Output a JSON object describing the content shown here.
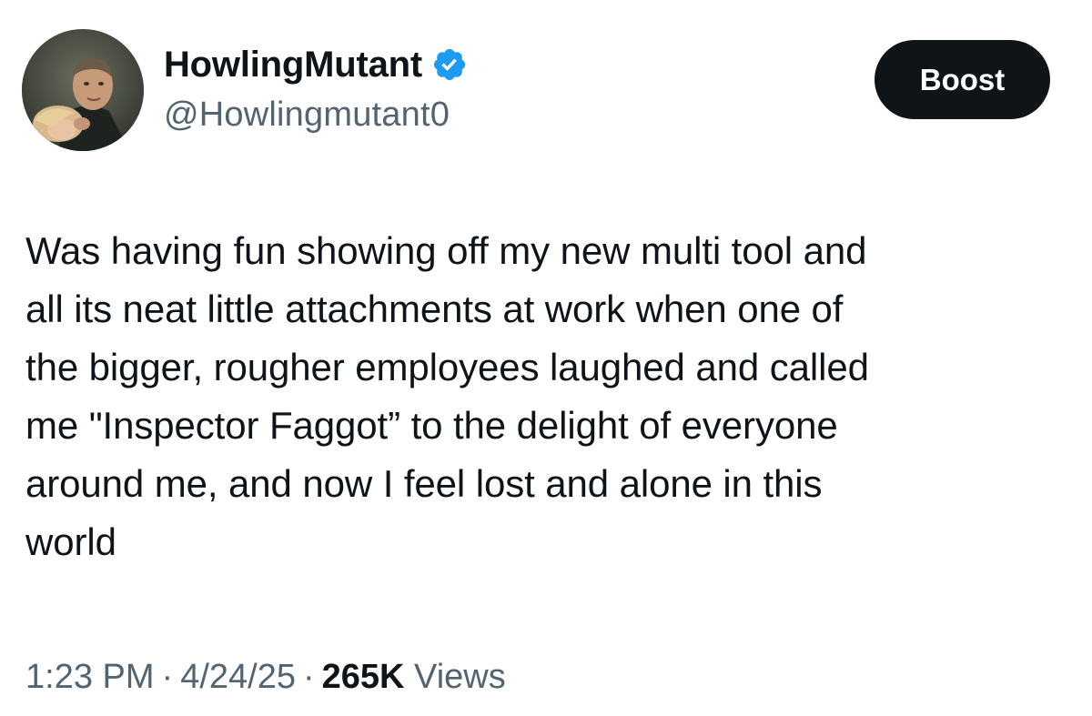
{
  "author": {
    "display_name": "HowlingMutant",
    "handle": "@Howlingmutant0",
    "verified": true,
    "avatar_icon": "profile-photo"
  },
  "actions": {
    "boost_label": "Boost"
  },
  "tweet": {
    "text": "Was having fun showing off my new multi tool and\nall its neat little attachments at work when one of\nthe bigger, rougher employees laughed and called\nme \"Inspector Faggot” to the delight of everyone\naround me, and now I feel lost and alone in this\nworld"
  },
  "meta": {
    "time": "1:23 PM",
    "separator": "·",
    "date": "4/24/25",
    "views_count": "265K",
    "views_label": "Views"
  },
  "colors": {
    "text_primary": "#0f1419",
    "text_secondary": "#536471",
    "verified_badge": "#1d9bf0",
    "button_bg": "#0f1419"
  }
}
